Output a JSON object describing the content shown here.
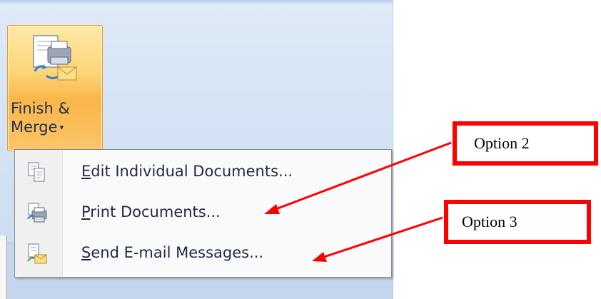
{
  "ribbon": {
    "finish_merge": {
      "line1": "Finish &",
      "line2": "Merge",
      "dropdown_glyph": "▾",
      "icon": "finish-merge-icon"
    }
  },
  "menu": {
    "items": [
      {
        "mnemonic": "E",
        "rest": "dit Individual Documents...",
        "icon": "edit-documents-icon"
      },
      {
        "mnemonic": "P",
        "rest": "rint Documents...",
        "icon": "print-documents-icon"
      },
      {
        "mnemonic": "S",
        "rest": "end E-mail Messages...",
        "icon": "send-email-icon"
      }
    ]
  },
  "callouts": {
    "option2": "Option 2",
    "option3": "Option 3"
  },
  "colors": {
    "callout_border": "#ff0000",
    "arrow": "#ff0000",
    "button_highlight": "#f9b54a"
  }
}
